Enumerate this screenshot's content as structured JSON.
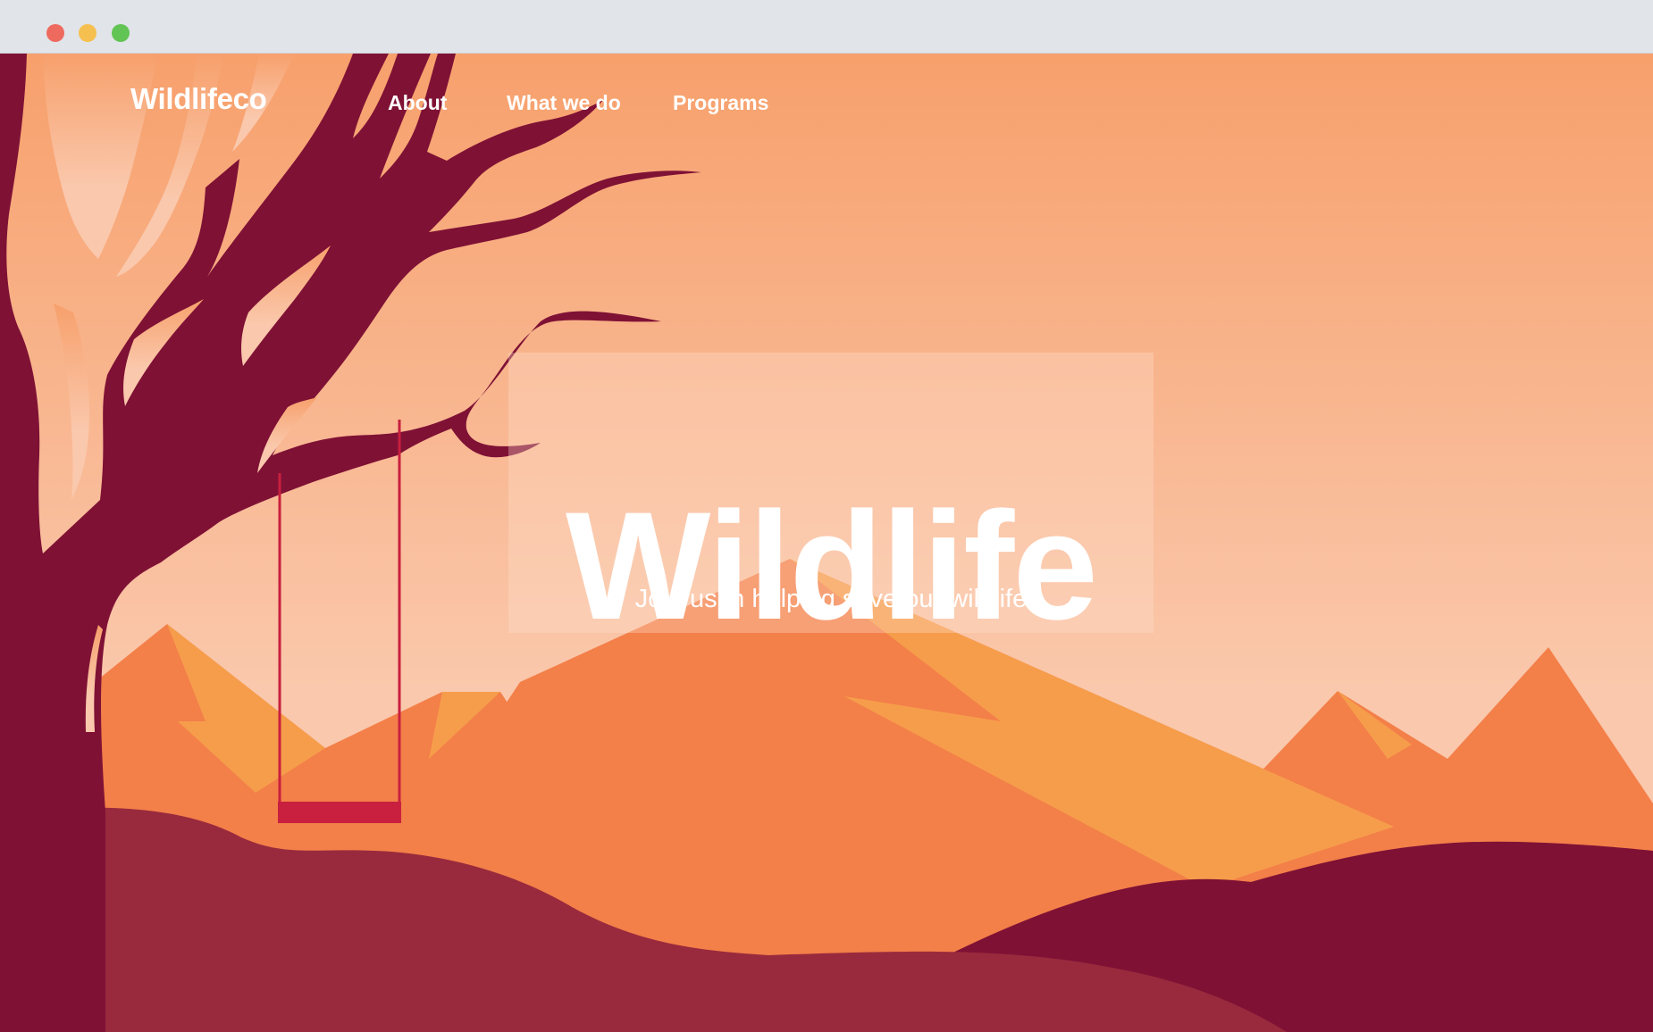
{
  "browser": {
    "controls": [
      "close",
      "minimize",
      "maximize"
    ]
  },
  "nav": {
    "brand": "Wildlifeco",
    "links": [
      {
        "label": "About"
      },
      {
        "label": "What we do"
      },
      {
        "label": "Programs"
      }
    ]
  },
  "hero": {
    "title": "Wildlife",
    "subtitle": "Join us in helping save our wildlife"
  },
  "colors": {
    "sky_top": "#f7a06c",
    "sky_bottom": "#fac8ac",
    "mountain_orange": "#f37f49",
    "mountain_light": "#f69d4b",
    "tree": "#7f1135",
    "hill_front": "#992a3d",
    "swing_seat": "#c8203e"
  }
}
